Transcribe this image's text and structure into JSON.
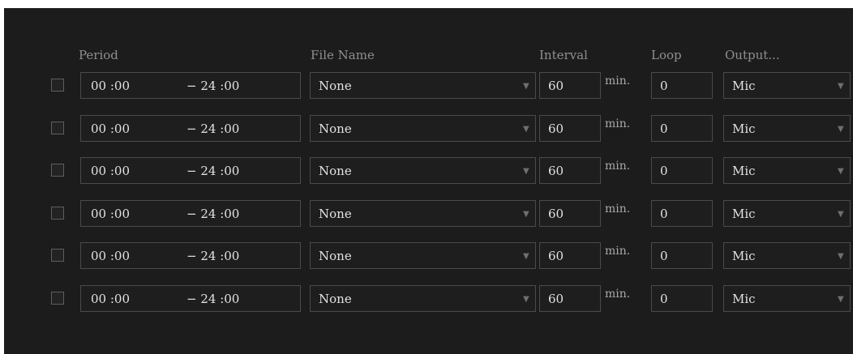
{
  "columns": {
    "period": "Period",
    "file_name": "File Name",
    "interval": "Interval",
    "loop": "Loop",
    "output": "Output..."
  },
  "rows": [
    {
      "checked": false,
      "start": "00 :00",
      "end": "− 24 :00",
      "file": "None",
      "interval": "60",
      "unit": "min.",
      "loop": "0",
      "output": "Mic"
    },
    {
      "checked": false,
      "start": "00 :00",
      "end": "− 24 :00",
      "file": "None",
      "interval": "60",
      "unit": "min.",
      "loop": "0",
      "output": "Mic"
    },
    {
      "checked": false,
      "start": "00 :00",
      "end": "− 24 :00",
      "file": "None",
      "interval": "60",
      "unit": "min.",
      "loop": "0",
      "output": "Mic"
    },
    {
      "checked": false,
      "start": "00 :00",
      "end": "− 24 :00",
      "file": "None",
      "interval": "60",
      "unit": "min.",
      "loop": "0",
      "output": "Mic"
    },
    {
      "checked": false,
      "start": "00 :00",
      "end": "− 24 :00",
      "file": "None",
      "interval": "60",
      "unit": "min.",
      "loop": "0",
      "output": "Mic"
    },
    {
      "checked": false,
      "start": "00 :00",
      "end": "− 24 :00",
      "file": "None",
      "interval": "60",
      "unit": "min.",
      "loop": "0",
      "output": "Mic"
    }
  ],
  "icons": {
    "dropdown": "triangle-down-icon",
    "checkbox": "checkbox-unchecked"
  },
  "colors": {
    "background": "#1c1c1c",
    "field": "#1e1e1e",
    "field_border": "#4a4a4a",
    "text": "#e2e2e2",
    "header_text": "#8f8f8f"
  }
}
